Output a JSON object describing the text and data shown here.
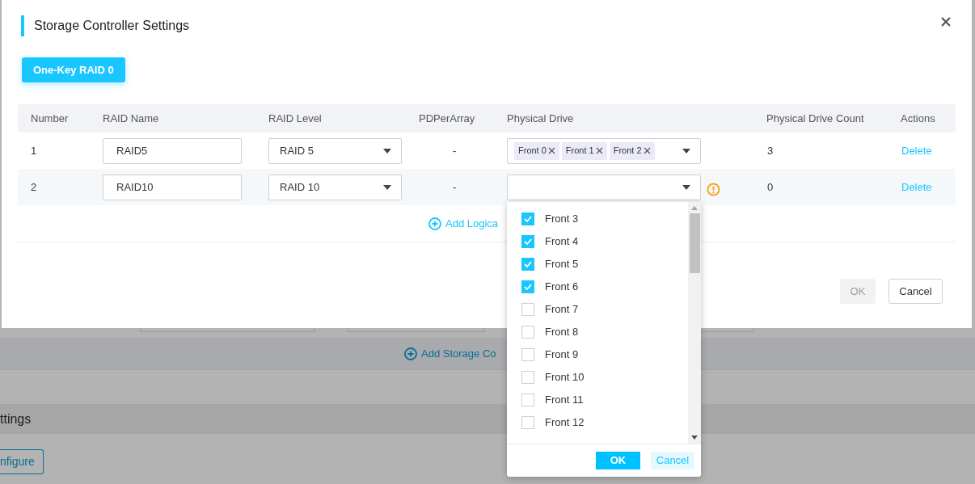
{
  "background": {
    "add_link": "Add Storage Co",
    "section_title": "ttings",
    "configure_button": "nfigure"
  },
  "dialog": {
    "title": "Storage Controller Settings",
    "one_key_button": "One-Key RAID 0",
    "table": {
      "columns": [
        "Number",
        "RAID Name",
        "RAID Level",
        "PDPerArray",
        "Physical Drive",
        "Physical Drive Count",
        "Actions"
      ],
      "rows": [
        {
          "number": "1",
          "raid_name": "RAID5",
          "raid_level": "RAID 5",
          "pd_per_array": "-",
          "drives": [
            "Front 0",
            "Front 1",
            "Front 2"
          ],
          "warning": false,
          "count": "3",
          "action": "Delete"
        },
        {
          "number": "2",
          "raid_name": "RAID10",
          "raid_level": "RAID 10",
          "pd_per_array": "-",
          "drives": [],
          "warning": true,
          "count": "0",
          "action": "Delete"
        }
      ]
    },
    "add_link": "Add Logica",
    "buttons": [
      {
        "label": "OK",
        "disabled": true
      },
      {
        "label": "Cancel",
        "disabled": false
      }
    ]
  },
  "dropdown": {
    "options": [
      {
        "label": "Front 3",
        "checked": true
      },
      {
        "label": "Front 4",
        "checked": true
      },
      {
        "label": "Front 5",
        "checked": true
      },
      {
        "label": "Front 6",
        "checked": true
      },
      {
        "label": "Front 7",
        "checked": false
      },
      {
        "label": "Front 8",
        "checked": false
      },
      {
        "label": "Front 9",
        "checked": false
      },
      {
        "label": "Front 10",
        "checked": false
      },
      {
        "label": "Front 11",
        "checked": false
      },
      {
        "label": "Front 12",
        "checked": false
      }
    ],
    "ok": "OK",
    "cancel": "Cancel"
  }
}
